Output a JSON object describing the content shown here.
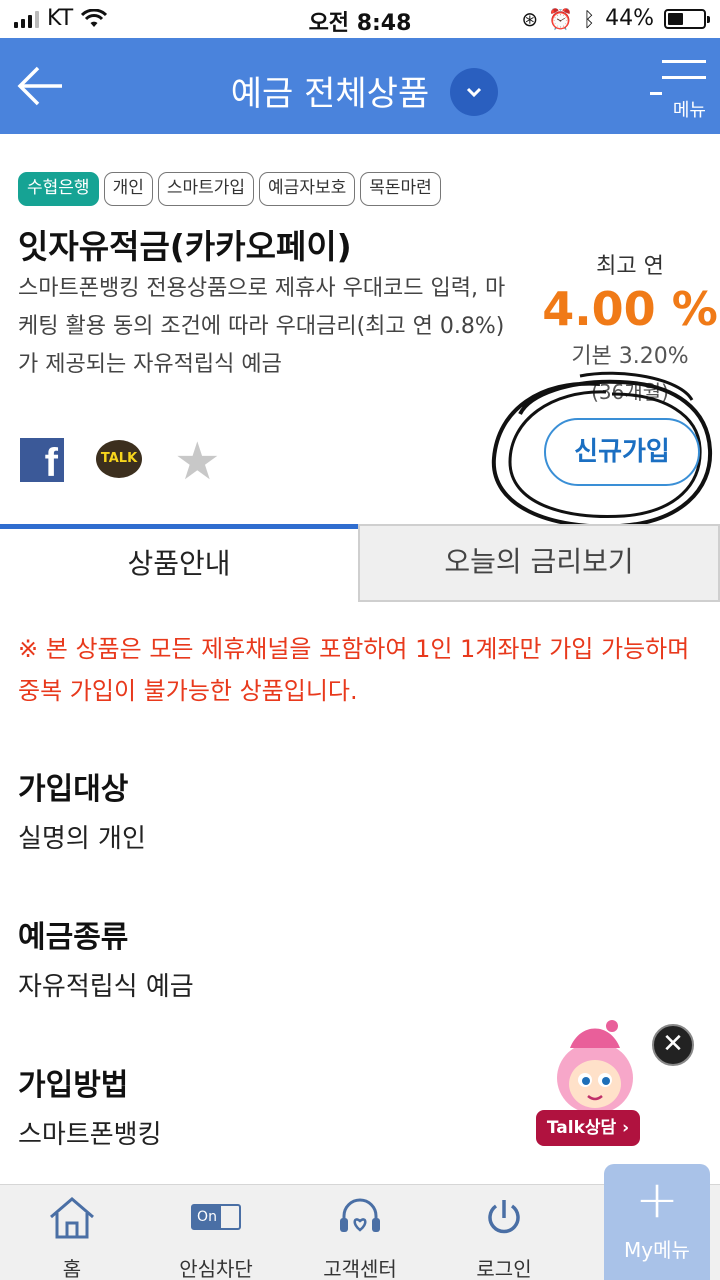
{
  "status_bar": {
    "carrier": "KT",
    "time": "오전 8:48",
    "battery": "44%",
    "battery_level": 0.44
  },
  "header": {
    "title": "예금 전체상품",
    "menu_label": "메뉴"
  },
  "product": {
    "tags": [
      "수협은행",
      "개인",
      "스마트가입",
      "예금자보호",
      "목돈마련"
    ],
    "name": "잇자유적금(카카오페이)",
    "description": "스마트폰뱅킹 전용상품으로 제휴사 우대코드 입력, 마케팅 활용 동의 조건에 따라 우대금리(최고 연 0.8%)가 제공되는 자유적립식 예금",
    "rate_label": "최고 연",
    "rate_value": "4.00 %",
    "rate_base": "기본 3.20%",
    "rate_term": "(36개월)",
    "signup_label": "신규가입",
    "share_kakao": "TALK"
  },
  "tabs": {
    "active": "상품안내",
    "inactive": "오늘의 금리보기"
  },
  "notice": "※ 본 상품은 모든 제휴채널을 포함하여 1인 1계좌만 가입 가능하며 중복 가입이 불가능한 상품입니다.",
  "sections": [
    {
      "title": "가입대상",
      "body": "실명의 개인"
    },
    {
      "title": "예금종류",
      "body": "자유적립식 예금"
    },
    {
      "title": "가입방법",
      "body": "스마트폰뱅킹"
    }
  ],
  "talk": {
    "label": "Talk상담 ›"
  },
  "bottom_nav": [
    {
      "label": "홈",
      "icon": "home-icon"
    },
    {
      "label": "안심차단",
      "icon": "toggle-on-icon",
      "toggle_text": "On"
    },
    {
      "label": "고객센터",
      "icon": "headset-icon"
    },
    {
      "label": "로그인",
      "icon": "power-icon"
    }
  ],
  "my_menu": {
    "label": "My메뉴"
  },
  "colors": {
    "header_bg": "#4a83dc",
    "rate_orange": "#f07a17",
    "notice_red": "#e8391c",
    "tag_green": "#16a394"
  }
}
